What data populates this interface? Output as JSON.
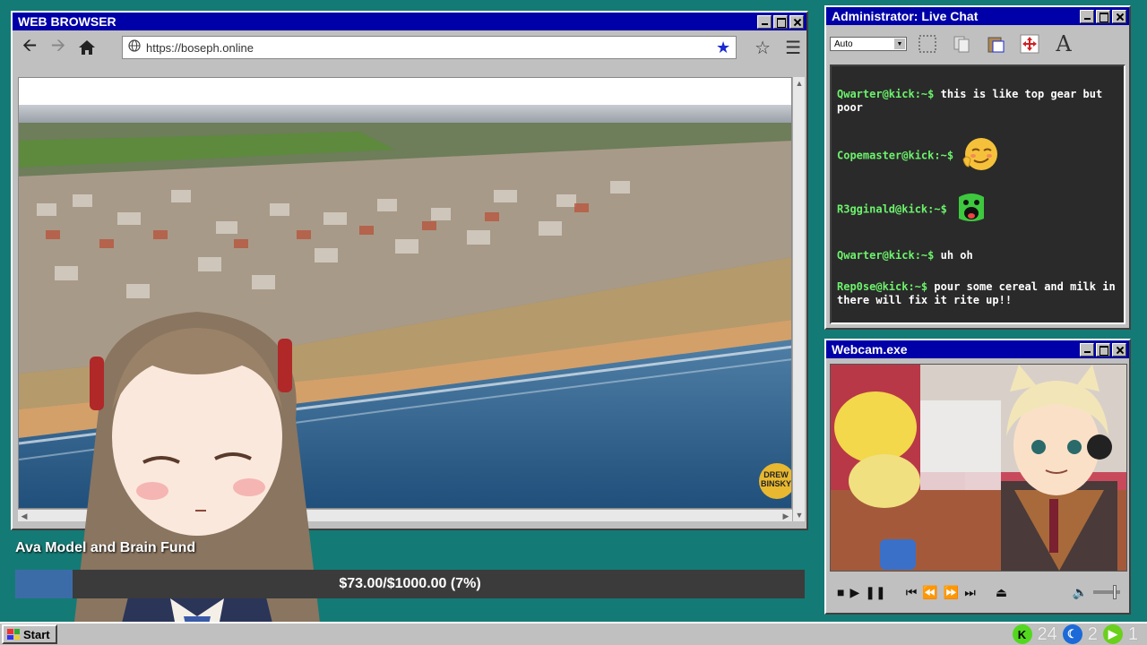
{
  "browser": {
    "title": "WEB BROWSER",
    "url": "https://boseph.online",
    "watermark": "DREW BINSKY"
  },
  "chat": {
    "title": "Administrator: Live Chat",
    "font_size": "Auto",
    "messages": [
      {
        "user": "Qwarter@kick:~$",
        "text": "this is like top gear but poor"
      },
      {
        "user": "Copemaster@kick:~$",
        "text": "",
        "emote": "smug-face"
      },
      {
        "user": "R3gginald@kick:~$",
        "text": "",
        "emote": "green-scream"
      },
      {
        "user": "Qwarter@kick:~$",
        "text": "uh oh"
      },
      {
        "user": "Rep0se@kick:~$",
        "text": "pour some cereal and milk in there will fix it rite up!!"
      }
    ]
  },
  "webcam": {
    "title": "Webcam.exe"
  },
  "fund": {
    "title": "Ava Model and Brain Fund",
    "text": "$73.00/$1000.00 (7%)",
    "fraction": 0.073
  },
  "taskbar": {
    "start": "Start",
    "tray": {
      "kick_count": "24",
      "moon_count": "2",
      "play_count": "1"
    }
  },
  "colors": {
    "desktop": "#147a75",
    "titlebar": "#0000a8",
    "chat_user": "#6cf26c",
    "fund_fill": "#3c6ca8"
  }
}
